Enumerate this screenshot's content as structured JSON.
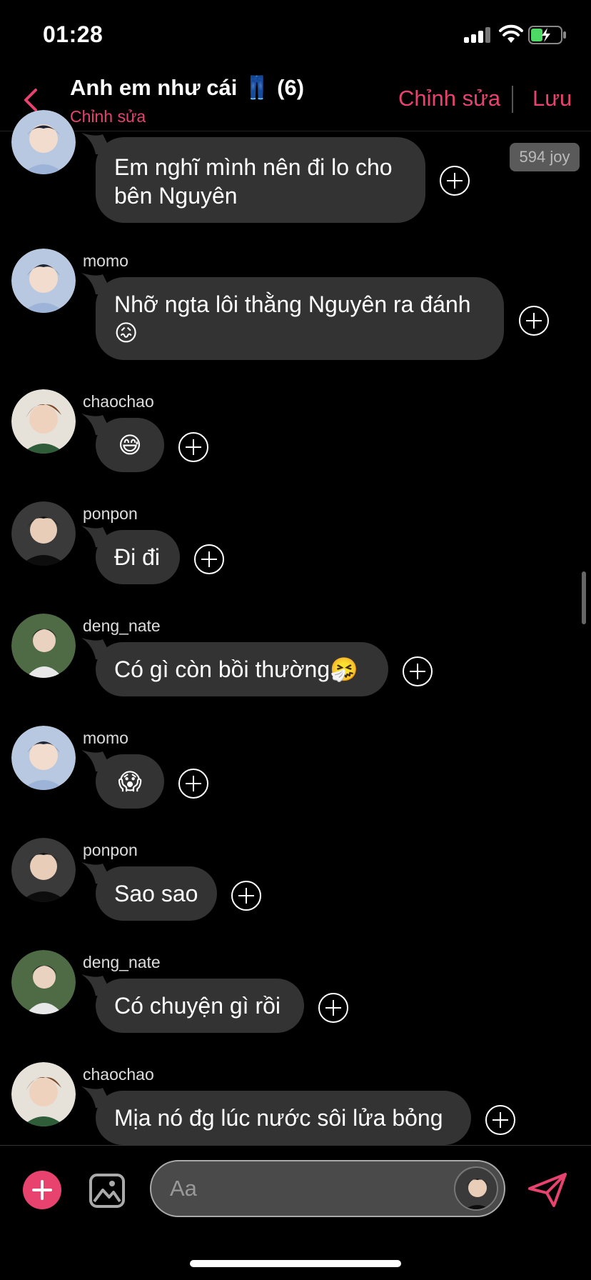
{
  "status": {
    "time": "01:28"
  },
  "header": {
    "title": "Anh em như cái 👖 (6)",
    "subtitle": "Chỉnh sửa",
    "edit_label": "Chỉnh sửa",
    "save_label": "Lưu"
  },
  "badge": "594 joy",
  "messages": [
    {
      "user": "",
      "text": "Em nghĩ mình nên đi lo cho bên Nguyên",
      "avatar": "light-blue"
    },
    {
      "user": "momo",
      "text": "Nhỡ ngta lôi thằng Nguyên ra đánh 😖",
      "avatar": "light-blue"
    },
    {
      "user": "chaochao",
      "text": "😅",
      "avatar": "warm"
    },
    {
      "user": "ponpon",
      "text": "Đi đi",
      "avatar": "dark"
    },
    {
      "user": "deng_nate",
      "text": "Có gì còn bồi thường🤧",
      "avatar": "green"
    },
    {
      "user": "momo",
      "text": "😱",
      "avatar": "light-blue"
    },
    {
      "user": "ponpon",
      "text": "Sao sao",
      "avatar": "dark"
    },
    {
      "user": "deng_nate",
      "text": "Có chuyện gì rồi",
      "avatar": "green"
    },
    {
      "user": "chaochao",
      "text": "Mịa nó đg lúc nước sôi lửa bỏng",
      "avatar": "warm"
    }
  ],
  "composer": {
    "placeholder": "Aa"
  },
  "colors": {
    "accent": "#e8436e",
    "bubble": "#333333",
    "background": "#000000"
  }
}
